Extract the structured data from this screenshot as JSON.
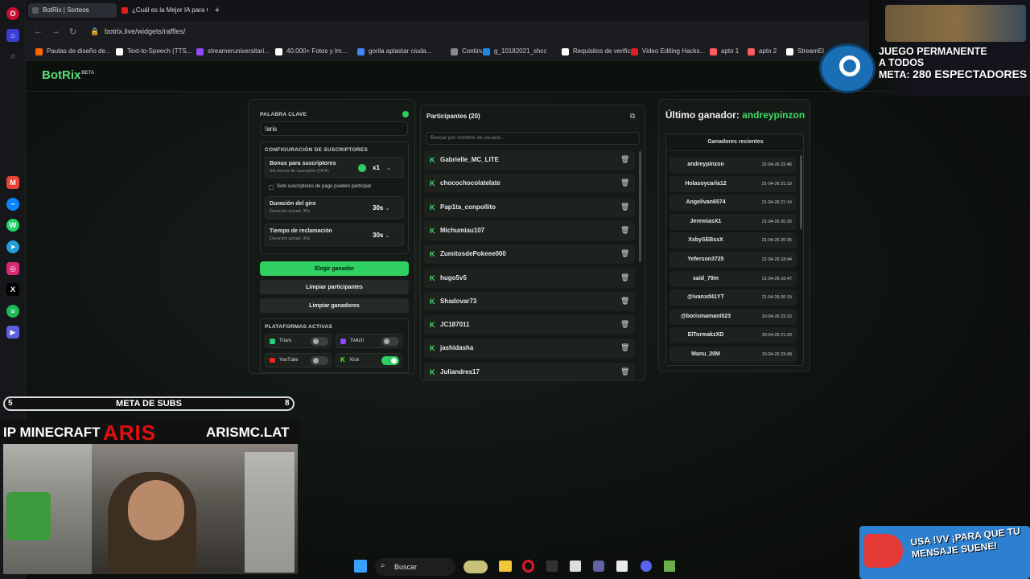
{
  "browser": {
    "tabs": [
      {
        "label": "BotRix | Sorteos",
        "color": "#5a5a5a"
      },
      {
        "label": "¿Cuál es la Mejor IA para C",
        "color": "#e02020"
      }
    ],
    "url": "botrix.live/widgets/raffles/",
    "bookmarks": [
      {
        "label": "Pautas de diseño de...",
        "color": "#ff6600"
      },
      {
        "label": "Text-to-Speech (TTS...",
        "color": "#ffffff"
      },
      {
        "label": "streameruniversitari...",
        "color": "#9146ff"
      },
      {
        "label": "40.000+ Fotos y Im...",
        "color": "#ffffff"
      },
      {
        "label": "gorila aplastar ciuda...",
        "color": "#4285f4"
      },
      {
        "label": "Continue",
        "color": "#888888"
      },
      {
        "label": "g_10182021_shcc",
        "color": "#1e88e5"
      },
      {
        "label": "Requisitos de verific...",
        "color": "#ffffff"
      },
      {
        "label": "Video Editing Hacks...",
        "color": "#e02020"
      },
      {
        "label": "apto 1",
        "color": "#ff5a5f"
      },
      {
        "label": "apto 2",
        "color": "#ff5a5f"
      },
      {
        "label": "StreamEl",
        "color": "#ffffff"
      }
    ]
  },
  "app": {
    "logo": "BotRix",
    "logo_badge": "BETA",
    "keyword": {
      "label": "PALABRA CLAVE",
      "value": "!aris"
    },
    "subs_config": {
      "label": "CONFIGURACIÓN DE SUSCRIPTORES",
      "bonus_title": "Bonus para suscriptores",
      "bonus_sub": "Sin bonus de suscriptor (OFF)",
      "bonus_value": "x1",
      "paid_only": "Solo suscriptores de pago pueden participar",
      "spin_title": "Duración del giro",
      "spin_sub": "Duración actual: 30s",
      "spin_value": "30s",
      "claim_title": "Tiempo de reclamación",
      "claim_sub": "Duración actual: 30s",
      "claim_value": "30s"
    },
    "buttons": {
      "pick": "Elegir ganador",
      "clear_participants": "Limpiar participantes",
      "clear_winners": "Limpiar ganadores"
    },
    "platforms": {
      "label": "PLATAFORMAS ACTIVAS",
      "items": [
        {
          "name": "Trovo",
          "on": false,
          "color": "#1fd27a"
        },
        {
          "name": "Twitch",
          "on": false,
          "color": "#9146ff"
        },
        {
          "name": "YouTube",
          "on": false,
          "color": "#ff2020"
        },
        {
          "name": "Kick",
          "on": true,
          "color": "#53fc18"
        }
      ]
    },
    "participants": {
      "title": "Participantes (20)",
      "search_placeholder": "Buscar por nombre de usuario...",
      "items": [
        "Gabrielle_MC_LITE",
        "chocochocolatelate",
        "Pap1ta_conpollito",
        "Michumiau107",
        "ZumitosdePokeee000",
        "hugo5v5",
        "Shadovar73",
        "JC187011",
        "jashidasha",
        "Juliandres17"
      ]
    },
    "last_winner": {
      "label": "Último ganador:",
      "name": "andreypinzon"
    },
    "recent": {
      "title": "Ganadores recientes",
      "items": [
        {
          "name": "andreypinzon",
          "date": "22-04-26 22:46"
        },
        {
          "name": "Holasoycarla12",
          "date": "21-04-26 21:19"
        },
        {
          "name": "Angelivan6574",
          "date": "21-04-26 21:14"
        },
        {
          "name": "JeremiasX1",
          "date": "21-04-26 20:39"
        },
        {
          "name": "XxbySEBsxX",
          "date": "21-04-26 20:35"
        },
        {
          "name": "Yeferson3725",
          "date": "21-04-26 18:44"
        },
        {
          "name": "said_79m",
          "date": "21-04-26 16:47"
        },
        {
          "name": "@ivanxd41YT",
          "date": "21-04-26 00:19"
        },
        {
          "name": "@borismamani523",
          "date": "20-04-26 22:10"
        },
        {
          "name": "ElTormakzXD",
          "date": "20-04-26 21:29"
        },
        {
          "name": "Manu_20M",
          "date": "19-04-26 23:49"
        }
      ]
    }
  },
  "overlays": {
    "steam_line1": "JUEGO PERMANENTE",
    "steam_line2": "A TODOS",
    "steam_meta_label": "META:",
    "steam_meta_value": "280 ESPECTADORES",
    "subs_start": "5",
    "subs_label": "META DE SUBS",
    "subs_goal": "8",
    "ip_left": "IP MINECRAFT",
    "ip_brand": "ARIS",
    "ip_right": "ARISMC.LAT",
    "msg_text": "USA !VV ¡PARA QUE TU MENSAJE SUENE!"
  },
  "taskbar": {
    "search": "Buscar"
  },
  "colors": {
    "accent": "#2fcf62",
    "winner": "#41d967"
  }
}
